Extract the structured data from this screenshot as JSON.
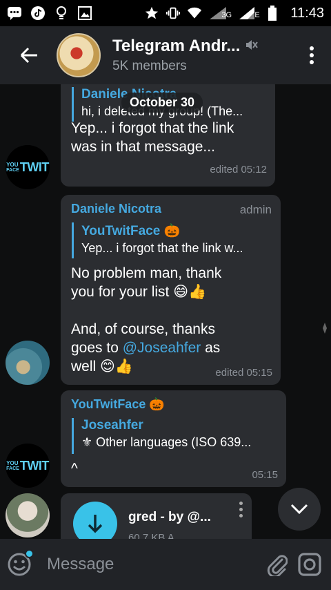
{
  "status_bar": {
    "time": "11:43",
    "network": "3G",
    "carrier_letter": "E",
    "icons": [
      "message-icon",
      "tiktok-icon",
      "lightbulb-icon",
      "image-icon",
      "star-icon",
      "vibrate-icon",
      "wifi-icon",
      "signal-icon",
      "signal-icon",
      "battery-icon"
    ]
  },
  "header": {
    "title": "Telegram Andr...",
    "members": "5K members",
    "muted": true
  },
  "chat": {
    "date_pill": "October 30",
    "messages": [
      {
        "reply_name": "Daniele Nicotra",
        "reply_text": "hi, i deleted my group! (The...",
        "text_line1": "Yep... i forgot that the link",
        "text_line2": "was in that message...",
        "time": "edited 05:12",
        "avatar_label_top": "YOU",
        "avatar_label_mid": "FACE",
        "avatar_label_big": "TWIT"
      },
      {
        "sender": "Daniele Nicotra",
        "badge": "admin",
        "reply_name": "YouTwitFace 🎃",
        "reply_text": "Yep... i forgot that the link w...",
        "text_line1": "No problem man, thank",
        "text_line2": "you for your list 😄👍",
        "text_line3": "And, of course, thanks",
        "text_line4_pre": "goes to ",
        "text_line4_mention": "@Joseahfer",
        "text_line4_post": " as",
        "text_line5": "well 😊👍",
        "time": "edited 05:15"
      },
      {
        "sender": "YouTwitFace 🎃",
        "reply_name": "Joseahfer",
        "reply_text": "⚜ Other languages (ISO 639...",
        "text": "^",
        "time": "05:15",
        "avatar_label_top": "YOU",
        "avatar_label_mid": "FACE",
        "avatar_label_big": "TWIT"
      },
      {
        "file_name": "gred - by @...",
        "file_size": "60.7 KB A"
      }
    ]
  },
  "input": {
    "placeholder": "Message"
  }
}
